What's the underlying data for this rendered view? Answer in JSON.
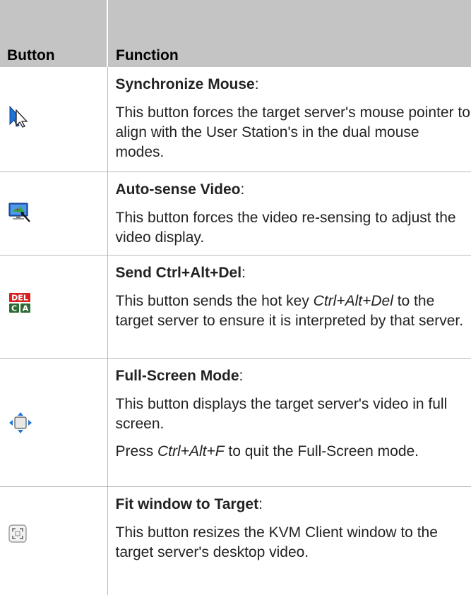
{
  "table": {
    "headers": {
      "button": "Button",
      "function": "Function"
    },
    "rows": [
      {
        "icon": "synchronize-mouse-icon",
        "title": "Synchronize Mouse",
        "title_suffix": ":",
        "body": "This button forces the target server's mouse pointer to align with the User Station's in the dual mouse modes."
      },
      {
        "icon": "auto-sense-video-icon",
        "title": "Auto-sense Video",
        "title_suffix": ":",
        "body": "This button forces the video re-sensing to adjust the video display."
      },
      {
        "icon": "ctrl-alt-del-icon",
        "title": "Send Ctrl+Alt+Del",
        "title_suffix": ":",
        "body_pre": "This button sends the hot key ",
        "body_key": "Ctrl+Alt+Del",
        "body_post": " to the target server to ensure it is interpreted by that server.",
        "icon_text_top": "DEL",
        "icon_text_c": "C",
        "icon_text_a": "A"
      },
      {
        "icon": "full-screen-mode-icon",
        "title": "Full-Screen Mode",
        "title_suffix": ":",
        "body": "This button displays the target server's video in full screen.",
        "extra_pre": "Press ",
        "extra_key": "Ctrl+Alt+F",
        "extra_post": " to quit the Full-Screen mode."
      },
      {
        "icon": "fit-window-icon",
        "title": "Fit window to Target",
        "title_suffix": ":",
        "body": "This button resizes the KVM Client window to the target server's desktop video."
      }
    ]
  },
  "colors": {
    "header_bg": "#c4c4c4",
    "rule": "#b8b8b8",
    "icon_blue": "#1e73d6",
    "del_red": "#d62020",
    "key_green": "#2e6b35"
  }
}
